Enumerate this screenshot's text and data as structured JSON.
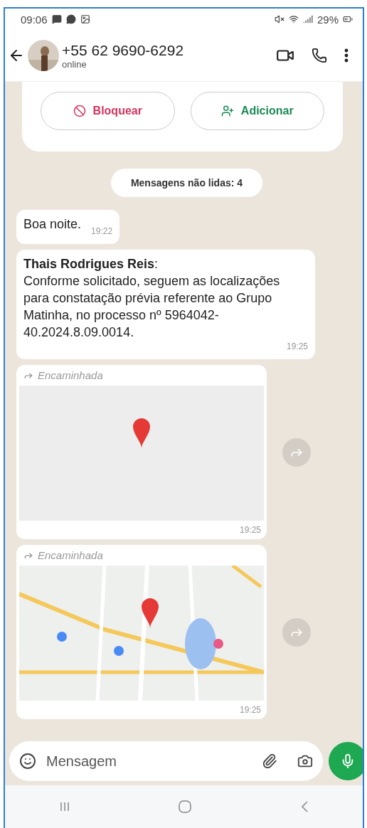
{
  "status_bar": {
    "time": "09:06",
    "battery": "29%"
  },
  "header": {
    "contact": "+55 62 9690-6292",
    "status": "online"
  },
  "contact_card": {
    "buttons": [
      {
        "kind": "block",
        "label": "Bloquear"
      },
      {
        "kind": "add",
        "label": "Adicionar"
      }
    ]
  },
  "unread_banner": "Mensagens não lidas: 4",
  "messages": [
    {
      "kind": "text",
      "text": "Boa noite.",
      "time": "19:22"
    },
    {
      "kind": "text",
      "sender": "**Thais Rodrigues Reis**:",
      "text": "Conforme solicitado, seguem as localizações para constatação prévia referente ao Grupo Matinha, no processo nº 5964042-40.2024.8.09.0014.",
      "time": "19:25"
    },
    {
      "kind": "location",
      "forwarded_label": "Encaminhada",
      "time": "19:25"
    },
    {
      "kind": "location",
      "forwarded_label": "Encaminhada",
      "time": "19:25"
    }
  ],
  "composer": {
    "placeholder": "Mensagem"
  }
}
